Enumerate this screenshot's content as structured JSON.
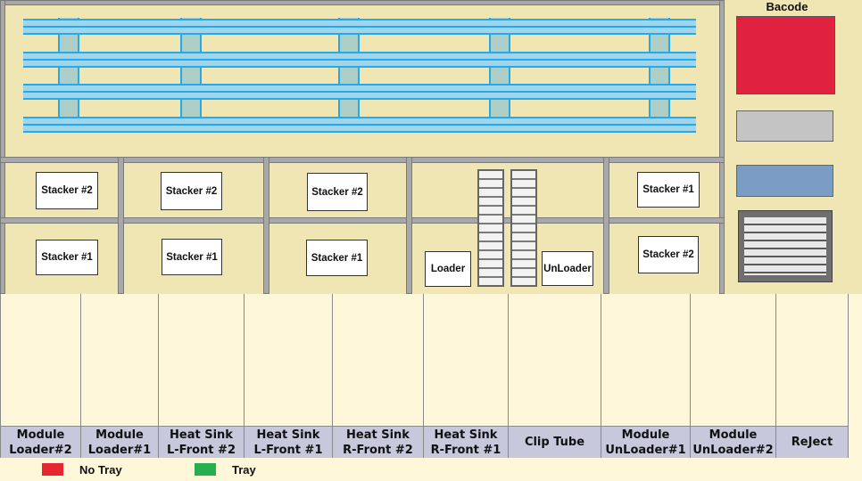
{
  "barcode": {
    "title": "Bacode"
  },
  "stackers": {
    "s1": "Stacker #2",
    "s2": "Stacker #2",
    "s3": "Stacker #2",
    "s4": "Stacker #1",
    "s5": "Stacker #1",
    "s6": "Stacker #1",
    "s7": "Stacker #1",
    "s8": "Stacker #2"
  },
  "loader": {
    "loader": "Loader",
    "unloader": "UnLoader"
  },
  "modules": [
    "Module\nLoader#2",
    "Module\nLoader#1",
    "Heat  Sink\nL-Front  #2",
    "Heat  Sink\nL-Front  #1",
    "Heat  Sink\nR-Front  #2",
    "Heat  Sink\nR-Front  #1",
    "Clip  Tube",
    "Module\nUnLoader#1",
    "Module\nUnLoader#2",
    "ReJect"
  ],
  "legend": {
    "no_tray": "No Tray",
    "tray": "Tray"
  },
  "colors": {
    "barcode_status": "#E0223F",
    "indicator_gray": "#C4C4C4",
    "indicator_blue": "#7B9CC4",
    "no_tray": "#E82630",
    "tray": "#27AE4F"
  }
}
